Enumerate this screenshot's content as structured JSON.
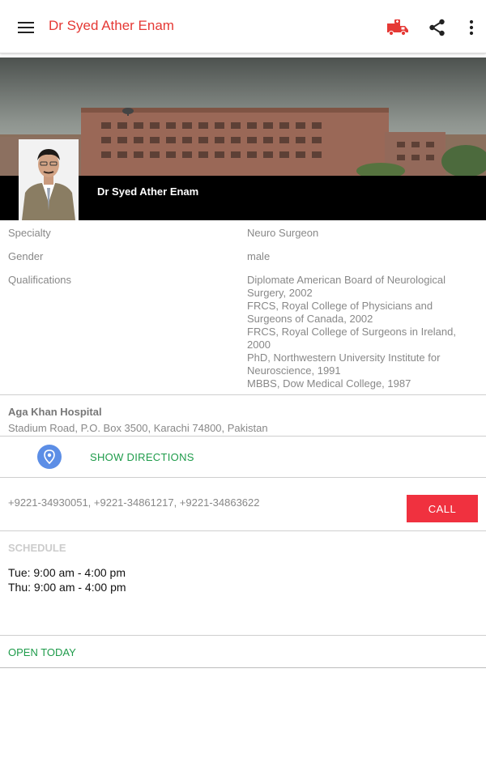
{
  "appbar": {
    "title": "Dr Syed Ather Enam",
    "icons": [
      "menu-icon",
      "ambulance-icon",
      "share-icon",
      "more-vert-icon"
    ]
  },
  "profile": {
    "name": "Dr Syed Ather Enam",
    "specialty_label": "Specialty",
    "specialty_value": "Neuro Surgeon",
    "gender_label": "Gender",
    "gender_value": "male",
    "qualifications_label": "Qualifications",
    "qualifications": [
      "Diplomate American Board of Neurological Surgery, 2002",
      "FRCS, Royal College of Physicians and Surgeons of Canada, 2002",
      "FRCS, Royal College of Surgeons in Ireland, 2000",
      "PhD, Northwestern University Institute for Neuroscience, 1991",
      "MBBS, Dow Medical College, 1987"
    ]
  },
  "hospital": {
    "name": "Aga Khan Hospital",
    "address": "Stadium Road, P.O. Box 3500, Karachi 74800, Pakistan",
    "directions_label": "SHOW DIRECTIONS"
  },
  "contact": {
    "phones": "+9221-34930051, +9221-34861217, +9221-34863622",
    "call_label": "CALL"
  },
  "schedule": {
    "header": "SCHEDULE",
    "entries": [
      "Tue: 9:00 am - 4:00 pm",
      "Thu: 9:00 am - 4:00 pm"
    ],
    "status": "OPEN TODAY"
  },
  "colors": {
    "accent_red": "#e53935",
    "call_red": "#f0313f",
    "green": "#1e9b4a",
    "pin_blue": "#5c8ee6"
  }
}
